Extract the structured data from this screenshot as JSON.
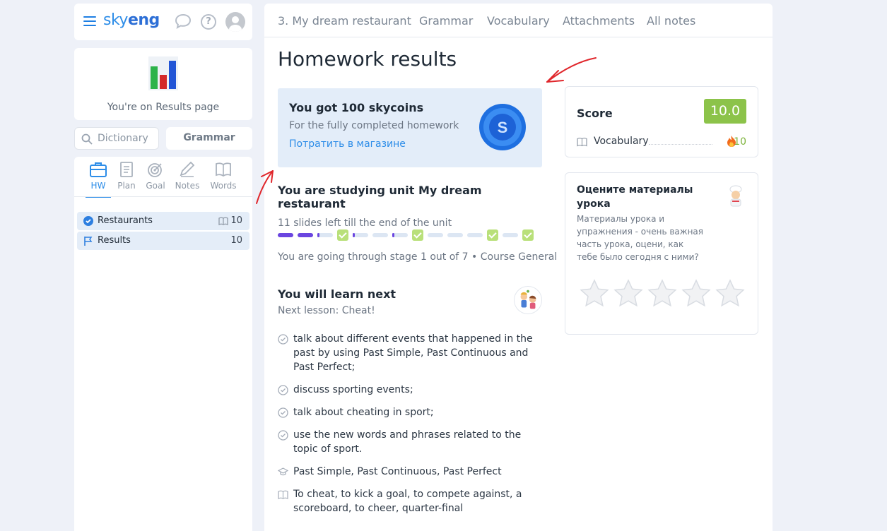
{
  "topbar": {
    "logo_part1": "sky",
    "logo_part2": "eng",
    "icons": [
      "menu-icon",
      "chat-icon",
      "help-icon",
      "avatar"
    ]
  },
  "results_card": {
    "text": "You're on Results page"
  },
  "dictionary": {
    "placeholder": "Dictionary"
  },
  "grammar_button": "Grammar",
  "tools": [
    {
      "label": "HW",
      "icon": "briefcase-icon",
      "active": true
    },
    {
      "label": "Plan",
      "icon": "plan-icon",
      "active": false
    },
    {
      "label": "Goal",
      "icon": "target-icon",
      "active": false
    },
    {
      "label": "Notes",
      "icon": "pencil-icon",
      "active": false
    },
    {
      "label": "Words",
      "icon": "book-icon",
      "active": false
    }
  ],
  "lessons": [
    {
      "label": "Restaurants",
      "count": "10",
      "icon": "check-circle-icon"
    },
    {
      "label": "Results",
      "count": "10",
      "icon": "flag-icon"
    }
  ],
  "tabs": [
    "3. My dream restaurant",
    "Grammar",
    "Vocabulary",
    "Attachments",
    "All notes"
  ],
  "main": {
    "title": "Homework results",
    "coins": {
      "title": "You got 100 skycoins",
      "subtitle": "For the fully completed homework",
      "link": "Потратить в магазине",
      "coin_letter": "S"
    },
    "unit": {
      "title": "You are studying unit My dream restaurant",
      "slides_left": "11 slides left till the end of the unit",
      "stage": "You are going through stage 1 out of 7 • Course General"
    },
    "next": {
      "title": "You will learn next",
      "subtitle": "Next lesson: Cheat!",
      "items": [
        {
          "icon": "check-circle-icon",
          "text": "talk about different events that happened in the past by using Past Simple, Past Continuous and Past Perfect;"
        },
        {
          "icon": "check-circle-icon",
          "text": "discuss sporting events;"
        },
        {
          "icon": "check-circle-icon",
          "text": "talk about cheating in sport;"
        },
        {
          "icon": "check-circle-icon",
          "text": "use the new words and phrases related to the topic of sport."
        },
        {
          "icon": "graduation-cap-icon",
          "text": "Past Simple, Past Continuous, Past Perfect"
        },
        {
          "icon": "book-icon",
          "text": "To cheat, to kick a goal, to compete against, a scoreboard, to cheer, quarter-final"
        }
      ]
    }
  },
  "score": {
    "label": "Score",
    "value": "10.0",
    "vocab_label": "Vocabulary",
    "vocab_value": "10",
    "colors": {
      "score_bg": "#8cc34a",
      "accent": "#2d8de8"
    }
  },
  "rate": {
    "title": "Оцените материалы урока",
    "description": "Материалы урока и упражнения - очень важная часть урока, оцени, как тебе было сегодня с ними?",
    "stars": 0,
    "max_stars": 5
  },
  "progress": {
    "segments": [
      "full",
      "full",
      "part",
      "check",
      "part",
      "empty",
      "part",
      "check",
      "empty",
      "empty",
      "empty",
      "check",
      "empty",
      "check"
    ]
  }
}
